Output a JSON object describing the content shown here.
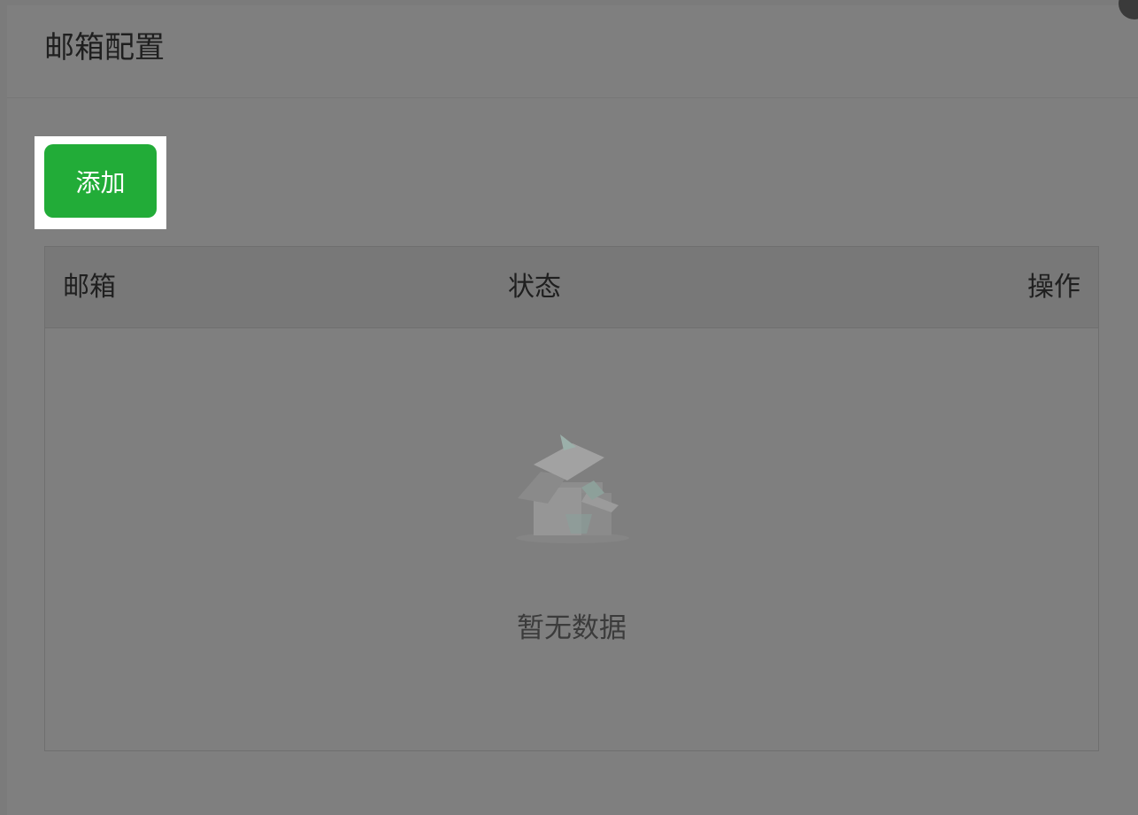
{
  "dialog": {
    "title": "邮箱配置"
  },
  "toolbar": {
    "add_label": "添加"
  },
  "table": {
    "columns": [
      "邮箱",
      "状态",
      "操作"
    ],
    "empty_text": "暂无数据",
    "empty_icon": "empty-box-icon"
  },
  "colors": {
    "overlay_background": "#7f7f7f",
    "primary_button": "#22ac38",
    "spotlight": "#ffffff"
  }
}
